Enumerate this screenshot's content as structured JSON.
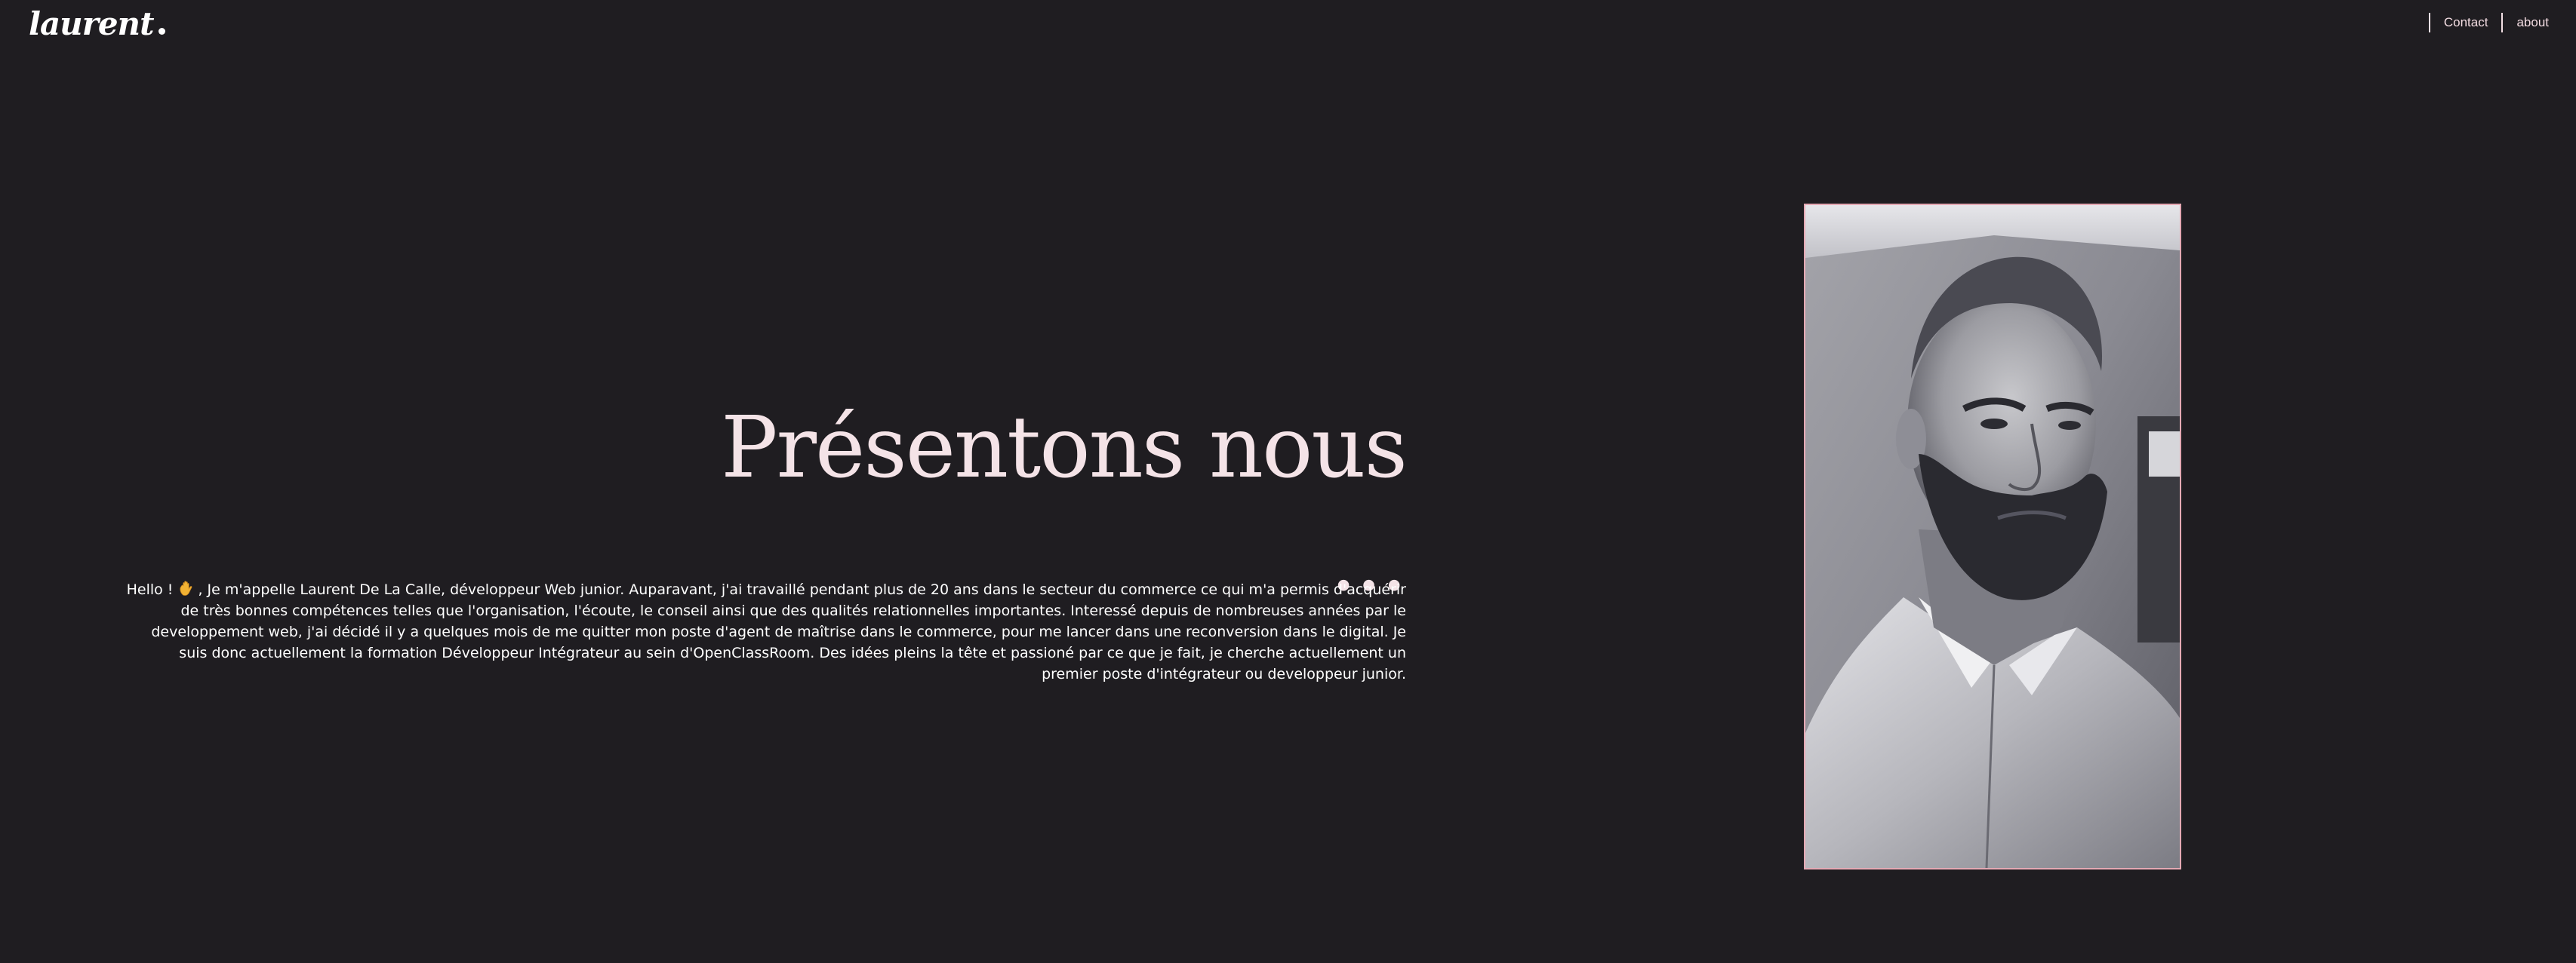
{
  "header": {
    "logo_text": "laurent",
    "nav": [
      {
        "label": "Contact"
      },
      {
        "label": "about"
      }
    ]
  },
  "hero": {
    "title": "Présentons nous ...",
    "intro_greeting": "Hello ! ",
    "intro_emoji": "waving-hand-icon",
    "intro_text": ", Je m'appelle Laurent De La Calle, développeur Web junior. Auparavant, j'ai travaillé pendant plus de 20 ans dans le secteur du commerce ce qui m'a permis d'acquérir de très bonnes compétences telles que l'organisation, l'écoute, le conseil ainsi que des qualités relationnelles importantes. Interessé depuis de nombreuses années par le developpement web, j'ai décidé il y a quelques mois de me quitter mon poste d'agent de maîtrise dans le commerce, pour me lancer dans une reconversion dans le digital. Je suis donc actuellement la formation Développeur Intégrateur au sein d'OpenClassRoom. Des idées pleins la tête et passioné par ce que je fait, je cherche actuellement un premier poste d'intégrateur ou developpeur junior."
  },
  "colors": {
    "background": "#1f1d21",
    "text": "#f1e4e7",
    "accent": "#e5a9b4"
  }
}
